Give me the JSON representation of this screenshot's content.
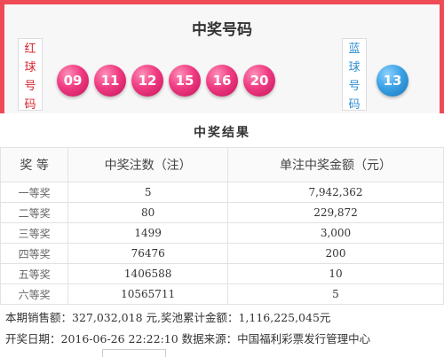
{
  "header": {
    "title": "中奖号码"
  },
  "red_label": [
    "红",
    "球",
    "号",
    "码"
  ],
  "blue_label": [
    "蓝",
    "球",
    "号",
    "码"
  ],
  "red_balls": [
    "09",
    "11",
    "12",
    "15",
    "16",
    "20"
  ],
  "blue_balls": [
    "13"
  ],
  "colors": {
    "brand": "#ee4b56",
    "red_ball": "#ef3b82",
    "blue_ball": "#3ba2e6"
  },
  "results": {
    "title": "中奖结果",
    "headers": [
      "奖 等",
      "中奖注数（注）",
      "单注中奖金额（元）"
    ],
    "rows": [
      {
        "level": "一等奖",
        "count": "5",
        "amount": "7,942,362"
      },
      {
        "level": "二等奖",
        "count": "80",
        "amount": "229,872"
      },
      {
        "level": "三等奖",
        "count": "1499",
        "amount": "3,000"
      },
      {
        "level": "四等奖",
        "count": "76476",
        "amount": "200"
      },
      {
        "level": "五等奖",
        "count": "1406588",
        "amount": "10"
      },
      {
        "level": "六等奖",
        "count": "10565711",
        "amount": "5"
      }
    ]
  },
  "info": {
    "line1": "本期销售额：327,032,018 元,奖池累计金额：1,116,225,045元",
    "line2": "开奖日期：2016-06-26 22:22:10 数据来源：中国福利彩票发行管理中心"
  }
}
